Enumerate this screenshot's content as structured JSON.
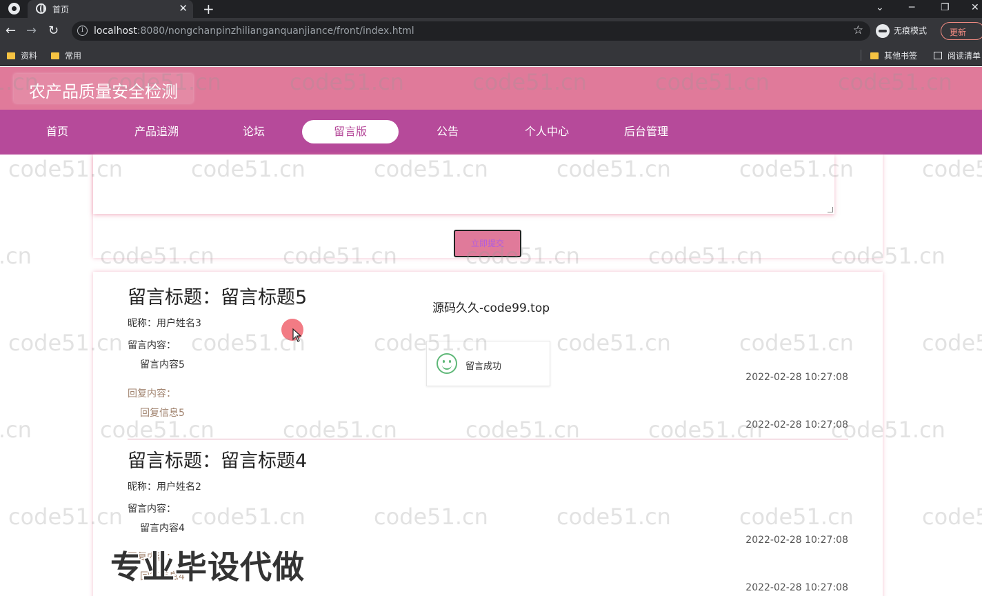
{
  "browser": {
    "tab_title": "首页",
    "url_host": "localhost",
    "url_path": ":8080/nongchanpinzhilianganquanjiance/front/index.html",
    "incognito_label": "无痕模式",
    "update_label": "更新",
    "bookmarks": [
      "资料",
      "常用"
    ],
    "bookmarks_right": [
      "其他书签",
      "阅读清单"
    ]
  },
  "site": {
    "title": "农产品质量安全检测",
    "nav": [
      "首页",
      "产品追溯",
      "论坛",
      "留言版",
      "公告",
      "个人中心",
      "后台管理"
    ],
    "active_nav": "留言版"
  },
  "form": {
    "submit_label": "立即提交"
  },
  "messages": [
    {
      "title": "留言标题：留言标题5",
      "nickname": "昵称：用户姓名3",
      "content_label": "留言内容：",
      "content": "留言内容5",
      "reply_label": "回复内容：",
      "reply": "回复信息5",
      "time1": "2022-02-28 10:27:08",
      "time2": "2022-02-28 10:27:08"
    },
    {
      "title": "留言标题：留言标题4",
      "nickname": "昵称：用户姓名2",
      "content_label": "留言内容：",
      "content": "留言内容4",
      "reply_label": "回复内容：",
      "reply": "回复信息4",
      "time1": "2022-02-28 10:27:08",
      "time2": "2022-02-28 10:27:08"
    }
  ],
  "toast": {
    "text": "留言成功"
  },
  "overlay": {
    "source_text": "源码久久-code99.top",
    "banner": "专业毕设代做",
    "watermark": "code51.cn"
  },
  "colors": {
    "header": "#e07a9a",
    "nav": "#b64a9a",
    "accent": "#e07a9a"
  }
}
